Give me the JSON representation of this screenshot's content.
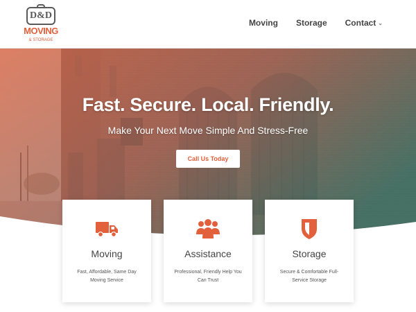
{
  "brand": {
    "logo_initials": "D&D",
    "logo_word": "MOVING",
    "logo_sub": "& STORAGE",
    "accent_color": "#e2603b"
  },
  "nav": {
    "items": [
      {
        "label": "Moving",
        "has_dropdown": false
      },
      {
        "label": "Storage",
        "has_dropdown": false
      },
      {
        "label": "Contact",
        "has_dropdown": true,
        "dropdown_icon": "chevron-down-icon"
      }
    ]
  },
  "hero": {
    "title": "Fast. Secure. Local. Friendly.",
    "subtitle": "Make Your Next Move Simple And Stress-Free",
    "cta_label": "Call Us Today",
    "overlay_colors": [
      "#e2603b",
      "#2e7f73"
    ]
  },
  "cards": [
    {
      "icon": "truck-icon",
      "title": "Moving",
      "text": "Fast, Affordable, Same Day Moving Service"
    },
    {
      "icon": "people-group-icon",
      "title": "Assistance",
      "text": "Professional, Friendly Help You Can Trust"
    },
    {
      "icon": "shield-icon",
      "title": "Storage",
      "text": "Secure & Comfortable Full-Service Storage"
    }
  ]
}
